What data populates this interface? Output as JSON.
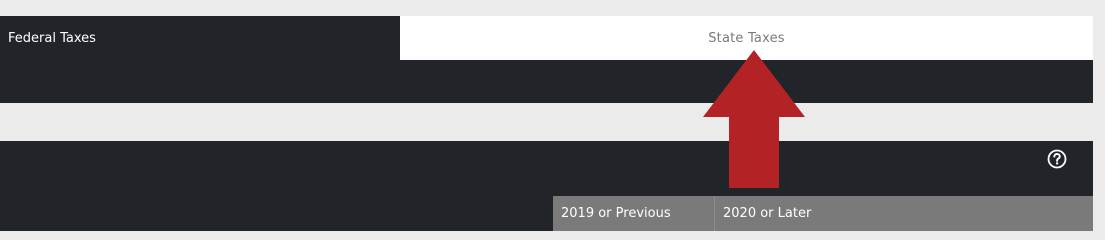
{
  "tabs": {
    "federal_label": "Federal Taxes",
    "state_label": "State Taxes"
  },
  "help": {
    "icon": "question-circle-icon"
  },
  "year_table": {
    "columns": [
      "2019 or Previous",
      "2020 or Later"
    ]
  },
  "annotation": {
    "icon": "arrow-up-icon",
    "color": "#b32325"
  },
  "colors": {
    "dark_panel": "#212429",
    "page_background": "#ebebeb",
    "header_gray": "#7a7a7a",
    "active_tab": "#ffffff"
  }
}
